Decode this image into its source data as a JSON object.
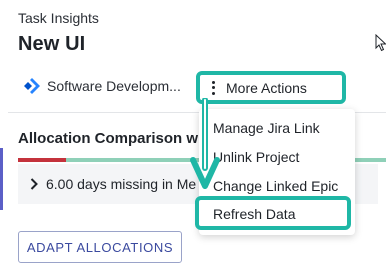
{
  "header": {
    "label": "Task Insights",
    "title": "New UI"
  },
  "project": {
    "name": "Software Developm...",
    "icon": "jira-icon"
  },
  "actions": {
    "more_label": "More Actions",
    "icon": "kebab-icon"
  },
  "section": {
    "title": "Allocation Comparison w",
    "missing_text": "6.00 days missing in Me",
    "missing_icon": "chevron-right-icon"
  },
  "menu": {
    "items": [
      {
        "label": "Manage Jira Link"
      },
      {
        "label": "Unlink Project"
      },
      {
        "label": "Change Linked Epic"
      },
      {
        "label": "Refresh Data"
      }
    ]
  },
  "adapt_button": {
    "label": "ADAPT ALLOCATIONS"
  },
  "colors": {
    "accent": "#1fb7a6",
    "progress_red": "#c4323c",
    "progress_green": "#8fd0b8",
    "button_text": "#3b4a9f"
  }
}
